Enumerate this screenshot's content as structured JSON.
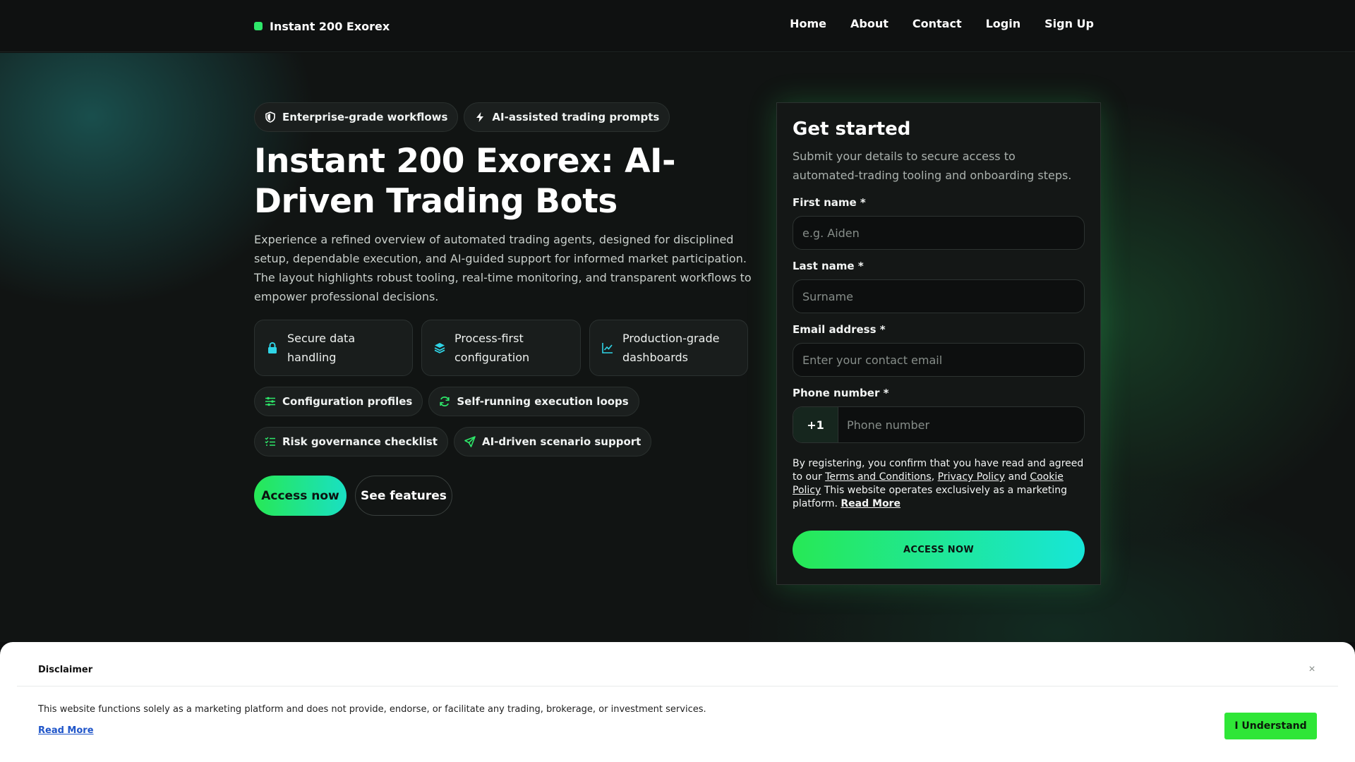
{
  "header": {
    "brand": "Instant 200 Exorex",
    "nav": [
      "Home",
      "About",
      "Contact",
      "Login",
      "Sign Up"
    ]
  },
  "hero": {
    "badges": [
      "Enterprise-grade workflows",
      "AI-assisted trading prompts"
    ],
    "title": "Instant 200 Exorex: AI-Driven Trading Bots",
    "lead": "Experience a refined overview of automated trading agents, designed for disciplined setup, dependable execution, and AI-guided support for informed market participation. The layout highlights robust tooling, real-time monitoring, and transparent workflows to empower professional decisions.",
    "features": [
      "Secure data handling",
      "Process-first configuration",
      "Production-grade dashboards"
    ],
    "tags_row1": [
      "Configuration profiles",
      "Self-running execution loops"
    ],
    "tags_row2": [
      "Risk governance checklist",
      "AI-driven scenario support"
    ],
    "primary_cta": "Access now",
    "secondary_cta": "See features"
  },
  "form": {
    "title": "Get started",
    "subtitle": "Submit your details to secure access to automated-trading tooling and onboarding steps.",
    "first_name_label": "First name *",
    "first_name_placeholder": "e.g. Aiden",
    "last_name_label": "Last name *",
    "last_name_placeholder": "Surname",
    "email_label": "Email address *",
    "email_placeholder": "Enter your contact email",
    "phone_label": "Phone number *",
    "phone_code": "+1",
    "phone_placeholder": "Phone number",
    "consent_prefix": "By registering, you confirm that you have read and agreed to our",
    "terms_link": "Terms and Conditions",
    "privacy_link": "Privacy Policy",
    "and_text": "and",
    "cookie_link": "Cookie Policy",
    "consent_suffix": "This website operates exclusively as a marketing platform.",
    "read_more": "Read More",
    "submit": "ACCESS NOW"
  },
  "disclaimer": {
    "title": "Disclaimer",
    "close": "×",
    "text": "This website functions solely as a marketing platform and does not provide, endorse, or facilitate any trading, brokerage, or investment services.",
    "read_more": "Read More",
    "button": "I Understand"
  },
  "colors": {
    "accent_green": "#2ee86a",
    "accent_cyan": "#19e0c3",
    "background": "#111413",
    "card": "#141716"
  }
}
